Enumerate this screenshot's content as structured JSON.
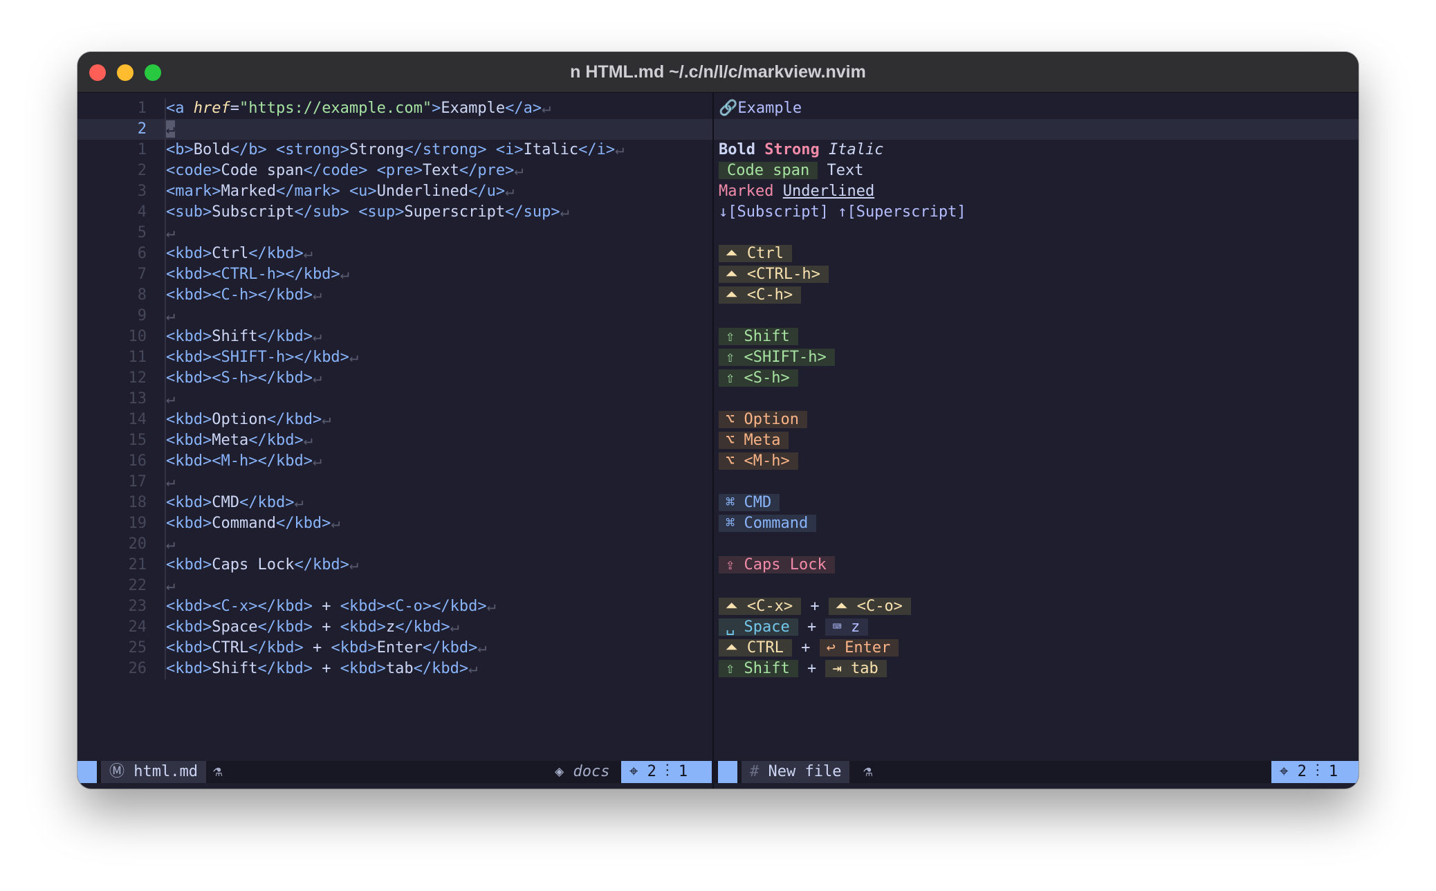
{
  "window": {
    "title": "n HTML.md ~/.c/n/l/c/markview.nvim"
  },
  "editor": {
    "lines": [
      {
        "num": "1",
        "code": [
          [
            "t-tag",
            "<a "
          ],
          [
            "t-attr",
            "href"
          ],
          [
            "t-b",
            "="
          ],
          [
            "t-str",
            "\"https://example.com\""
          ],
          [
            "t-tag",
            ">"
          ],
          [
            "t-b",
            "Example"
          ],
          [
            "t-tag",
            "</a>"
          ]
        ]
      },
      {
        "num": "2",
        "code": [],
        "current": true
      },
      {
        "num": "1",
        "code": [
          [
            "t-tag",
            "<b>"
          ],
          [
            "t-b",
            "Bold"
          ],
          [
            "t-tag",
            "</b>"
          ],
          [
            "t-b",
            " "
          ],
          [
            "t-tag",
            "<strong>"
          ],
          [
            "t-b",
            "Strong"
          ],
          [
            "t-tag",
            "</strong>"
          ],
          [
            "t-b",
            " "
          ],
          [
            "t-tag",
            "<i>"
          ],
          [
            "t-b",
            "Italic"
          ],
          [
            "t-tag",
            "</i>"
          ]
        ]
      },
      {
        "num": "2",
        "code": [
          [
            "t-tag",
            "<code>"
          ],
          [
            "t-b",
            "Code span"
          ],
          [
            "t-tag",
            "</code>"
          ],
          [
            "t-b",
            " "
          ],
          [
            "t-tag",
            "<pre>"
          ],
          [
            "t-b",
            "Text"
          ],
          [
            "t-tag",
            "</pre>"
          ]
        ]
      },
      {
        "num": "3",
        "code": [
          [
            "t-tag",
            "<mark>"
          ],
          [
            "t-b",
            "Marked"
          ],
          [
            "t-tag",
            "</mark>"
          ],
          [
            "t-b",
            " "
          ],
          [
            "t-tag",
            "<u>"
          ],
          [
            "t-b",
            "Underlined"
          ],
          [
            "t-tag",
            "</u>"
          ]
        ]
      },
      {
        "num": "4",
        "code": [
          [
            "t-tag",
            "<sub>"
          ],
          [
            "t-b",
            "Subscript"
          ],
          [
            "t-tag",
            "</sub>"
          ],
          [
            "t-b",
            " "
          ],
          [
            "t-tag",
            "<sup>"
          ],
          [
            "t-b",
            "Superscript"
          ],
          [
            "t-tag",
            "</sup>"
          ]
        ]
      },
      {
        "num": "5",
        "code": []
      },
      {
        "num": "6",
        "code": [
          [
            "t-tag",
            "<kbd>"
          ],
          [
            "t-b",
            "Ctrl"
          ],
          [
            "t-tag",
            "</kbd>"
          ]
        ]
      },
      {
        "num": "7",
        "code": [
          [
            "t-tag",
            "<kbd>"
          ],
          [
            "t-tag",
            "<CTRL-h>"
          ],
          [
            "t-tag",
            "</kbd>"
          ]
        ]
      },
      {
        "num": "8",
        "code": [
          [
            "t-tag",
            "<kbd>"
          ],
          [
            "t-tag",
            "<C-h>"
          ],
          [
            "t-tag",
            "</kbd>"
          ]
        ]
      },
      {
        "num": "9",
        "code": []
      },
      {
        "num": "10",
        "code": [
          [
            "t-tag",
            "<kbd>"
          ],
          [
            "t-b",
            "Shift"
          ],
          [
            "t-tag",
            "</kbd>"
          ]
        ]
      },
      {
        "num": "11",
        "code": [
          [
            "t-tag",
            "<kbd>"
          ],
          [
            "t-tag",
            "<SHIFT-h>"
          ],
          [
            "t-tag",
            "</kbd>"
          ]
        ]
      },
      {
        "num": "12",
        "code": [
          [
            "t-tag",
            "<kbd>"
          ],
          [
            "t-tag",
            "<S-h>"
          ],
          [
            "t-tag",
            "</kbd>"
          ]
        ]
      },
      {
        "num": "13",
        "code": []
      },
      {
        "num": "14",
        "code": [
          [
            "t-tag",
            "<kbd>"
          ],
          [
            "t-b",
            "Option"
          ],
          [
            "t-tag",
            "</kbd>"
          ]
        ]
      },
      {
        "num": "15",
        "code": [
          [
            "t-tag",
            "<kbd>"
          ],
          [
            "t-b",
            "Meta"
          ],
          [
            "t-tag",
            "</kbd>"
          ]
        ]
      },
      {
        "num": "16",
        "code": [
          [
            "t-tag",
            "<kbd>"
          ],
          [
            "t-tag",
            "<M-h>"
          ],
          [
            "t-tag",
            "</kbd>"
          ]
        ]
      },
      {
        "num": "17",
        "code": []
      },
      {
        "num": "18",
        "code": [
          [
            "t-tag",
            "<kbd>"
          ],
          [
            "t-b",
            "CMD"
          ],
          [
            "t-tag",
            "</kbd>"
          ]
        ]
      },
      {
        "num": "19",
        "code": [
          [
            "t-tag",
            "<kbd>"
          ],
          [
            "t-b",
            "Command"
          ],
          [
            "t-tag",
            "</kbd>"
          ]
        ]
      },
      {
        "num": "20",
        "code": []
      },
      {
        "num": "21",
        "code": [
          [
            "t-tag",
            "<kbd>"
          ],
          [
            "t-b",
            "Caps Lock"
          ],
          [
            "t-tag",
            "</kbd>"
          ]
        ]
      },
      {
        "num": "22",
        "code": []
      },
      {
        "num": "23",
        "code": [
          [
            "t-tag",
            "<kbd>"
          ],
          [
            "t-tag",
            "<C-x>"
          ],
          [
            "t-tag",
            "</kbd>"
          ],
          [
            "t-b",
            " + "
          ],
          [
            "t-tag",
            "<kbd>"
          ],
          [
            "t-tag",
            "<C-o>"
          ],
          [
            "t-tag",
            "</kbd>"
          ]
        ]
      },
      {
        "num": "24",
        "code": [
          [
            "t-tag",
            "<kbd>"
          ],
          [
            "t-b",
            "Space"
          ],
          [
            "t-tag",
            "</kbd>"
          ],
          [
            "t-b",
            " + "
          ],
          [
            "t-tag",
            "<kbd>"
          ],
          [
            "t-b",
            "z"
          ],
          [
            "t-tag",
            "</kbd>"
          ]
        ]
      },
      {
        "num": "25",
        "code": [
          [
            "t-tag",
            "<kbd>"
          ],
          [
            "t-b",
            "CTRL"
          ],
          [
            "t-tag",
            "</kbd>"
          ],
          [
            "t-b",
            " + "
          ],
          [
            "t-tag",
            "<kbd>"
          ],
          [
            "t-b",
            "Enter"
          ],
          [
            "t-tag",
            "</kbd>"
          ]
        ]
      },
      {
        "num": "26",
        "code": [
          [
            "t-tag",
            "<kbd>"
          ],
          [
            "t-b",
            "Shift"
          ],
          [
            "t-tag",
            "</kbd>"
          ],
          [
            "t-b",
            " + "
          ],
          [
            "t-tag",
            "<kbd>"
          ],
          [
            "t-b",
            "tab"
          ],
          [
            "t-tag",
            "</kbd>"
          ]
        ]
      }
    ],
    "eol_glyph": "↵"
  },
  "preview": {
    "link": {
      "icon": "🔗",
      "text": "Example"
    },
    "bold": "Bold",
    "strong": "Strong",
    "italic": "Italic",
    "code_span": "Code span",
    "pre_text": "Text",
    "marked": "Marked",
    "underlined": "Underlined",
    "subscript": "↓[Subscript]",
    "superscript": "↑[Superscript]",
    "kbd_lines": [
      [
        {
          "cls": "k-ctrl",
          "icon": "⏶",
          "text": "Ctrl"
        }
      ],
      [
        {
          "cls": "k-ctrl",
          "icon": "⏶",
          "text": "<CTRL-h>"
        }
      ],
      [
        {
          "cls": "k-ctrl",
          "icon": "⏶",
          "text": "<C-h>"
        }
      ],
      [],
      [
        {
          "cls": "k-shift",
          "icon": "⇧",
          "text": "Shift"
        }
      ],
      [
        {
          "cls": "k-shift",
          "icon": "⇧",
          "text": "<SHIFT-h>"
        }
      ],
      [
        {
          "cls": "k-shift",
          "icon": "⇧",
          "text": "<S-h>"
        }
      ],
      [],
      [
        {
          "cls": "k-opt",
          "icon": "⌥",
          "text": "Option"
        }
      ],
      [
        {
          "cls": "k-opt",
          "icon": "⌥",
          "text": "Meta"
        }
      ],
      [
        {
          "cls": "k-opt",
          "icon": "⌥",
          "text": "<M-h>"
        }
      ],
      [],
      [
        {
          "cls": "k-cmd",
          "icon": "⌘",
          "text": "CMD"
        }
      ],
      [
        {
          "cls": "k-cmd",
          "icon": "⌘",
          "text": "Command"
        }
      ],
      [],
      [
        {
          "cls": "k-caps",
          "icon": "⇪",
          "text": "Caps Lock"
        }
      ],
      [],
      [
        {
          "cls": "k-ctrl",
          "icon": "⏶",
          "text": "<C-x>"
        },
        {
          "cls": "k-ctrl",
          "icon": "⏶",
          "text": "<C-o>"
        }
      ],
      [
        {
          "cls": "k-spc",
          "icon": "␣",
          "text": "Space"
        },
        {
          "cls": "k-def",
          "icon": "⌨",
          "text": "z"
        }
      ],
      [
        {
          "cls": "k-ctrl",
          "icon": "⏶",
          "text": "CTRL"
        },
        {
          "cls": "k-ent",
          "icon": "↩",
          "text": "Enter"
        }
      ],
      [
        {
          "cls": "k-shift",
          "icon": "⇧",
          "text": "Shift"
        },
        {
          "cls": "k-tab",
          "icon": "⇥",
          "text": "tab"
        }
      ]
    ],
    "plus": "+"
  },
  "statusbar_left": {
    "file_icon": "md-file-icon",
    "file_icon_glyph": "Ⓜ",
    "file_name": "html.md",
    "flask_glyph": "⚗",
    "branch_glyph": "◈",
    "branch": "docs",
    "pos_glyph": "⌖",
    "line": "2",
    "col_glyph": "⋮",
    "col": "1"
  },
  "statusbar_right": {
    "file_icon_glyph": "#",
    "file_name": "New file",
    "flask_glyph": "⚗",
    "pos_glyph": "⌖",
    "line": "2",
    "col_glyph": "⋮",
    "col": "1"
  },
  "colors": {
    "background": "#1e1e2e",
    "accent": "#89b4fa",
    "statusbar": "#181825"
  }
}
